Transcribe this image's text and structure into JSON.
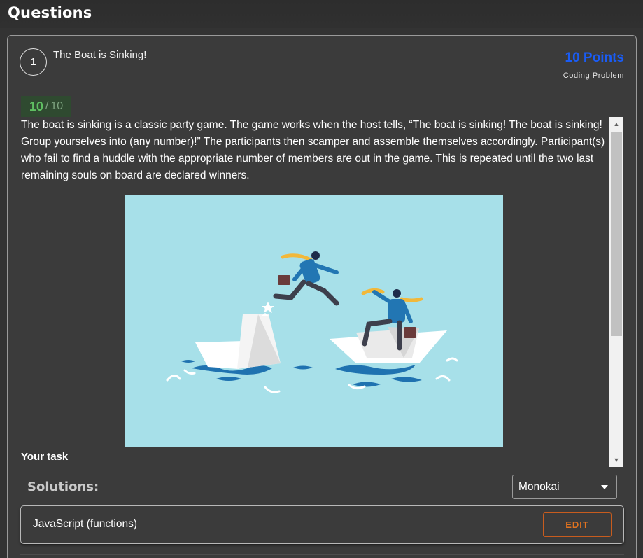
{
  "page": {
    "title": "Questions"
  },
  "question": {
    "number": "1",
    "title": "The Boat is Sinking!",
    "points": "10 Points",
    "type": "Coding Problem",
    "score": {
      "earned": "10",
      "separator": "/",
      "total": "10"
    },
    "description": "The boat is sinking is a classic party game. The game works when the host tells, “The boat is sinking! The boat is sinking! Group yourselves into (any number)!” The participants then scamper and assemble themselves accordingly. Participant(s) who fail to find a huddle with the appropriate number of members are out in the game. This is repeated until the two last remaining souls on board are declared winners.",
    "task_heading": "Your task"
  },
  "solutions": {
    "label": "Solutions:",
    "theme": "Monokai",
    "items": [
      {
        "language": "JavaScript (functions)",
        "action": "EDIT"
      }
    ]
  },
  "colors": {
    "points": "#1a5cf5",
    "score_earned": "#5fbf62",
    "edit": "#e2731f",
    "illustration_bg": "#a7e0e9"
  }
}
